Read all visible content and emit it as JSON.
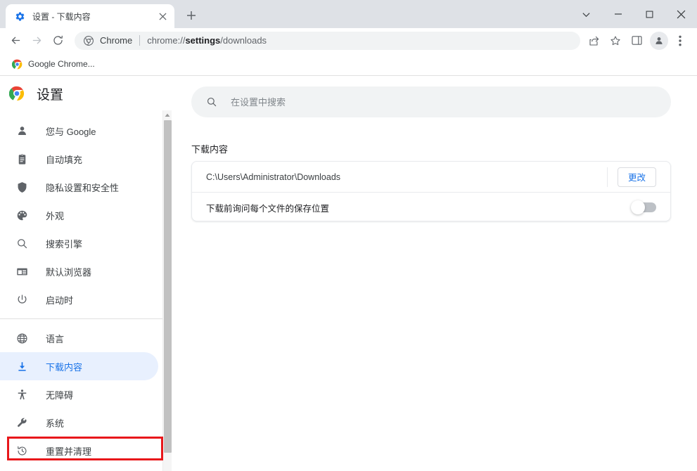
{
  "window": {
    "tab": {
      "title": "设置 - 下载内容",
      "favicon": "gear-icon",
      "close_label": "×"
    },
    "new_tab_label": "+",
    "controls": {
      "tab_search": "⌄",
      "minimize": "−",
      "maximize": "□",
      "close": "✕"
    }
  },
  "toolbar": {
    "back": "←",
    "forward": "→",
    "reload": "⟳",
    "omnibox": {
      "chrome_label": "Chrome",
      "url_prefix": "chrome://",
      "url_bold": "settings",
      "url_suffix": "/downloads"
    },
    "share": "share-icon",
    "bookmark": "star-icon",
    "side_panel": "side-panel-icon",
    "profile": "profile-avatar",
    "menu": "three-dot-menu"
  },
  "bookmarks": [
    {
      "label": "Google Chrome...",
      "icon": "chrome-logo"
    }
  ],
  "settings": {
    "title": "设置",
    "search": {
      "placeholder": "在设置中搜索",
      "value": "",
      "icon": "search-icon"
    },
    "nav": [
      {
        "id": "you-and-google",
        "label": "您与 Google",
        "icon": "person-icon",
        "active": false
      },
      {
        "id": "autofill",
        "label": "自动填充",
        "icon": "clipboard-icon",
        "active": false
      },
      {
        "id": "privacy-security",
        "label": "隐私设置和安全性",
        "icon": "shield-icon",
        "active": false
      },
      {
        "id": "appearance",
        "label": "外观",
        "icon": "palette-icon",
        "active": false
      },
      {
        "id": "search-engine",
        "label": "搜索引擎",
        "icon": "magnifier-icon",
        "active": false
      },
      {
        "id": "default-browser",
        "label": "默认浏览器",
        "icon": "browser-window-icon",
        "active": false
      },
      {
        "id": "on-startup",
        "label": "启动时",
        "icon": "power-icon",
        "active": false
      },
      {
        "id": "languages",
        "label": "语言",
        "icon": "globe-icon",
        "active": false
      },
      {
        "id": "downloads",
        "label": "下载内容",
        "icon": "download-icon",
        "active": true
      },
      {
        "id": "accessibility",
        "label": "无障碍",
        "icon": "accessibility-icon",
        "active": false
      },
      {
        "id": "system",
        "label": "系统",
        "icon": "wrench-icon",
        "active": false
      },
      {
        "id": "reset-cleanup",
        "label": "重置并清理",
        "icon": "restore-icon",
        "active": false
      }
    ],
    "page": {
      "section_title": "下载内容",
      "location_row": {
        "path": "C:\\Users\\Administrator\\Downloads",
        "change_button": "更改"
      },
      "ask_row": {
        "label": "下载前询问每个文件的保存位置",
        "toggle_on": false
      }
    }
  },
  "colors": {
    "accent": "#1a73e8",
    "active_bg": "#e8f0fe",
    "annotation": "#e8171b",
    "tabstrip_bg": "#dee1e6",
    "omnibox_bg": "#f1f3f4"
  }
}
